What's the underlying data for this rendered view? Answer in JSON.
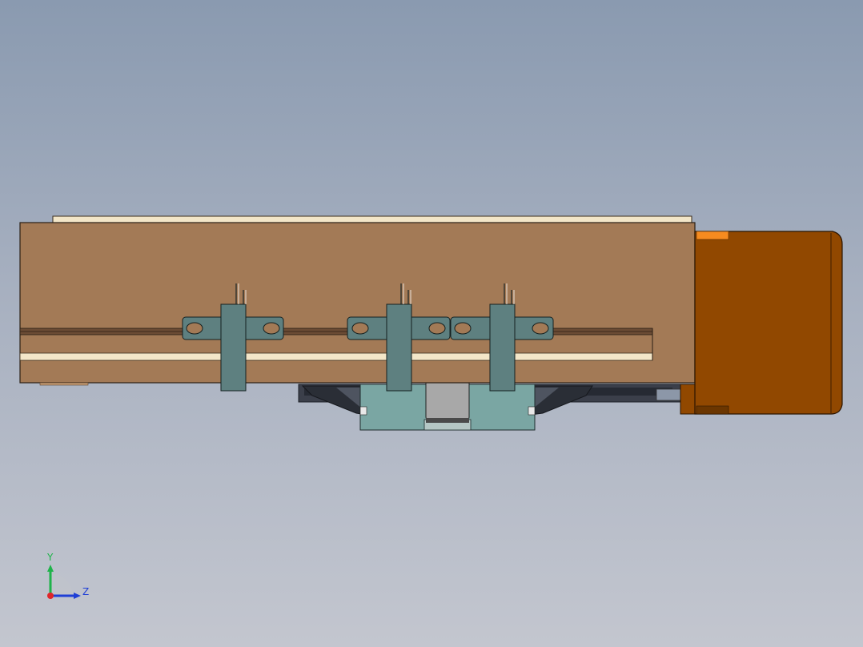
{
  "viewport": {
    "background_top": "#8a9ab0",
    "background_bottom": "#c3c6cf"
  },
  "model": {
    "body_color": "#a37a56",
    "rail_color": "#f3e6c8",
    "motor_color": "#914800",
    "motor_accent": "#f68b1f",
    "bracket_color": "#5e8080",
    "carriage_color": "#7aa6a3",
    "gray_block_color": "#a8a8a8",
    "dark_part_color": "#2f3542",
    "icon": "linear-actuator-model"
  },
  "triad": {
    "y_label": "Y",
    "z_label": "Z",
    "y_color": "#1fb34a",
    "z_color": "#1f3fd6",
    "x_color": "#e0262a",
    "icon": "coordinate-triad-icon"
  }
}
